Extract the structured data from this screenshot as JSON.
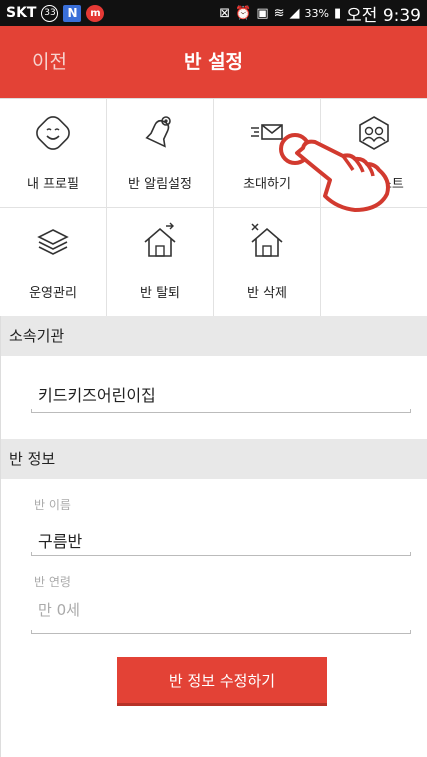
{
  "status_bar": {
    "carrier": "SKT",
    "badge_count": "33",
    "badge_n": "N",
    "badge_m": "m",
    "battery_percent": "33%",
    "time": "오전 9:39"
  },
  "header": {
    "back_label": "이전",
    "title": "반 설정"
  },
  "menu": [
    {
      "label": "내 프로필",
      "icon": "profile-face-icon"
    },
    {
      "label": "반 알림설정",
      "icon": "bell-icon"
    },
    {
      "label": "초대하기",
      "icon": "mail-send-icon"
    },
    {
      "label": "멤버리스트",
      "icon": "members-icon"
    },
    {
      "label": "운영관리",
      "icon": "layers-icon"
    },
    {
      "label": "반 탈퇴",
      "icon": "house-leave-icon"
    },
    {
      "label": "반 삭제",
      "icon": "house-delete-icon"
    }
  ],
  "affiliation": {
    "section_title": "소속기관",
    "value": "키드키즈어린이집"
  },
  "class_info": {
    "section_title": "반 정보",
    "name_label": "반 이름",
    "name_value": "구름반",
    "age_label": "반 연령",
    "age_placeholder": "만 0세"
  },
  "submit_label": "반 정보 수정하기",
  "colors": {
    "accent": "#e34236",
    "section_bg": "#e8e8e8",
    "hint": "#aaaaaa"
  }
}
